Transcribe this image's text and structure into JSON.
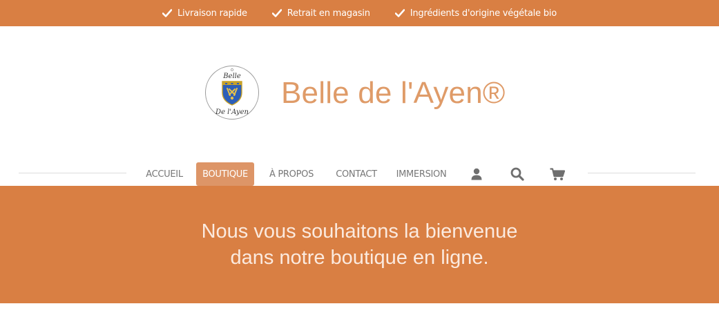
{
  "topbar": {
    "features": [
      {
        "icon": "check-icon",
        "label": "Livraison rapide"
      },
      {
        "icon": "check-icon",
        "label": "Retrait en magasin"
      },
      {
        "icon": "check-icon",
        "label": "Ingrédients d'origine végétale bio"
      }
    ]
  },
  "header": {
    "logo": {
      "icon": "brand-logo-icon",
      "text_top": "Belle",
      "text_bottom": "De l'Ayen"
    },
    "title": "Belle de l'Ayen®"
  },
  "nav": {
    "items": [
      {
        "label": "ACCUEIL",
        "active": false
      },
      {
        "label": "BOUTIQUE",
        "active": true
      },
      {
        "label": "À PROPOS",
        "active": false
      },
      {
        "label": "CONTACT",
        "active": false
      },
      {
        "label": "IMMERSION",
        "active": false
      }
    ],
    "icons": [
      "user-icon",
      "search-icon",
      "cart-icon"
    ]
  },
  "banner": {
    "line1": "Nous vous souhaitons la bienvenue",
    "line2": "dans notre boutique en ligne."
  },
  "colors": {
    "accent": "#d97f43",
    "brand_text": "#df9b68",
    "nav_active": "#dd9567",
    "nav_text": "#777777",
    "banner_text": "#fbeadf"
  }
}
